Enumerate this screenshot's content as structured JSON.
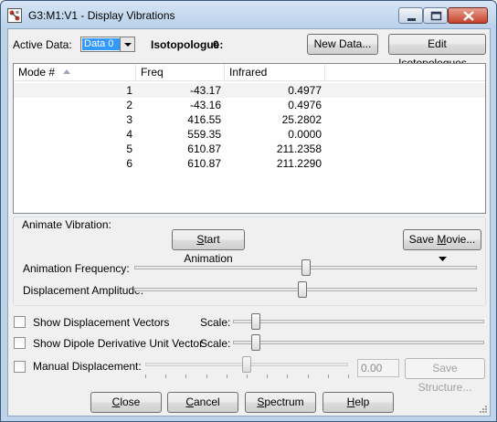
{
  "window": {
    "title": "G3:M1:V1 - Display Vibrations"
  },
  "top": {
    "active_data_label": "Active Data:",
    "active_data_value": "Data 0",
    "isotopologue_label": "Isotopologue:",
    "isotopologue_value": "0",
    "new_data_button": "New Data...",
    "edit_isotopologues_button": "Edit Isotopologues..."
  },
  "table": {
    "columns": [
      "Mode #",
      "Freq",
      "Infrared"
    ],
    "rows": [
      {
        "mode": "1",
        "freq": "-43.17",
        "ir": "0.4977"
      },
      {
        "mode": "2",
        "freq": "-43.16",
        "ir": "0.4976"
      },
      {
        "mode": "3",
        "freq": "416.55",
        "ir": "25.2802"
      },
      {
        "mode": "4",
        "freq": "559.35",
        "ir": "0.0000"
      },
      {
        "mode": "5",
        "freq": "610.87",
        "ir": "211.2358"
      },
      {
        "mode": "6",
        "freq": "610.87",
        "ir": "211.2290"
      }
    ]
  },
  "animate": {
    "group_label": "Animate Vibration:",
    "start_button": "Start Animation",
    "save_movie_button": "Save Movie...",
    "frequency_label": "Animation Frequency:",
    "frequency_level": 0.5,
    "amplitude_label": "Displacement Amplitude:",
    "amplitude_level": 0.49
  },
  "options": {
    "show_vectors_label": "Show Displacement Vectors",
    "show_vectors_checked": false,
    "vectors_scale_label": "Scale:",
    "vectors_scale_level": 0.09,
    "show_dipole_label": "Show Dipole Derivative Unit Vector",
    "show_dipole_checked": false,
    "dipole_scale_label": "Scale:",
    "dipole_scale_level": 0.09,
    "manual_label": "Manual Displacement:",
    "manual_checked": false,
    "manual_value": "0.00",
    "save_structure_button": "Save Structure..."
  },
  "bottom": {
    "close_button": "Close",
    "cancel_button": "Cancel",
    "spectrum_button": "Spectrum",
    "help_button": "Help"
  }
}
